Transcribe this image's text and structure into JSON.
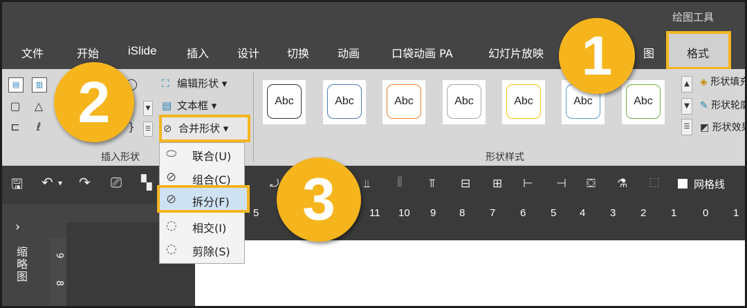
{
  "context_tab_label": "绘图工具",
  "tabs": [
    "文件",
    "开始",
    "iSlide",
    "插入",
    "设计",
    "切换",
    "动画",
    "口袋动画 PA",
    "幻灯片放映",
    "图"
  ],
  "active_tab": "格式",
  "ribbon": {
    "insert_shapes_group": "插入形状",
    "shape_styles_group": "形状样式",
    "edit_shape": "编辑形状",
    "text_box": "文本框",
    "merge_shapes": "合并形状",
    "gallery_text": "Abc",
    "gallery_borders": [
      "#333333",
      "#4a7ab8",
      "#ed7d31",
      "#a5a5a5",
      "#ffc000",
      "#5b9bd5",
      "#70ad47"
    ],
    "right_commands": [
      "形状填充",
      "形状轮廓",
      "形状效果"
    ]
  },
  "merge_menu": {
    "items": [
      "联合(U)",
      "组合(C)",
      "拆分(F)",
      "相交(I)",
      "剪除(S)"
    ],
    "highlighted": "拆分(F)"
  },
  "qat": {
    "gridlines_label": "网格线"
  },
  "ruler_numbers": [
    "5",
    "11",
    "10",
    "9",
    "8",
    "7",
    "6",
    "5",
    "4",
    "3",
    "2",
    "1",
    "0",
    "1"
  ],
  "left_pane": {
    "title": "缩略图",
    "ruler_numbers": [
      "9",
      "8"
    ]
  },
  "badges": [
    "1",
    "2",
    "3"
  ],
  "colors": {
    "highlight_border": "#f3b521",
    "badge": "#f6b51d",
    "ribbon_bg": "#d7d7d7",
    "dark_bg": "#444444"
  }
}
